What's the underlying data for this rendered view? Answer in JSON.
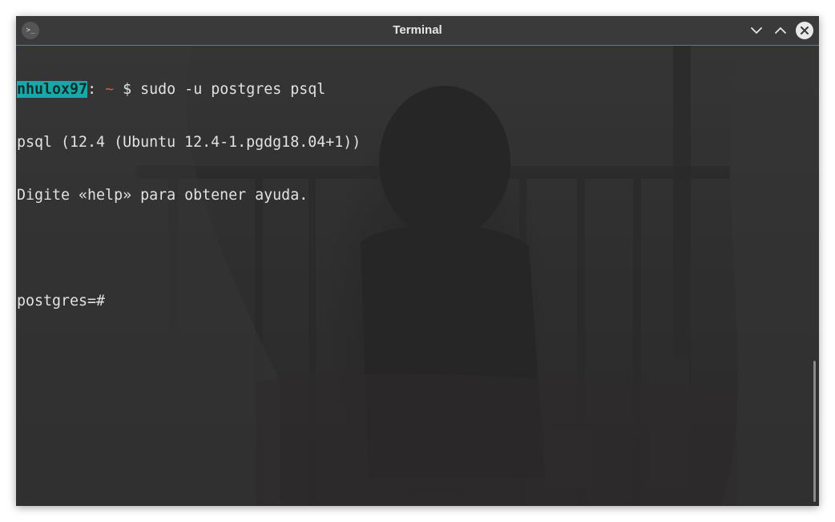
{
  "window": {
    "title": "Terminal",
    "app_icon": "terminal-icon",
    "buttons": [
      "chevron-down-icon",
      "chevron-up-icon",
      "close-icon"
    ]
  },
  "terminal": {
    "prompt": {
      "user": "nhulox97",
      "separator": ":",
      "path": "~",
      "symbol": "$",
      "command": "sudo -u postgres psql"
    },
    "output": [
      "psql (12.4 (Ubuntu 12.4-1.pgdg18.04+1))",
      "Digite «help» para obtener ayuda."
    ],
    "psql_prompt": "postgres=#"
  },
  "colors": {
    "accent": "#5b6fd6",
    "user_highlight": "#19a8a8",
    "tilde": "#e45c2a",
    "text": "#e2e2e2"
  }
}
